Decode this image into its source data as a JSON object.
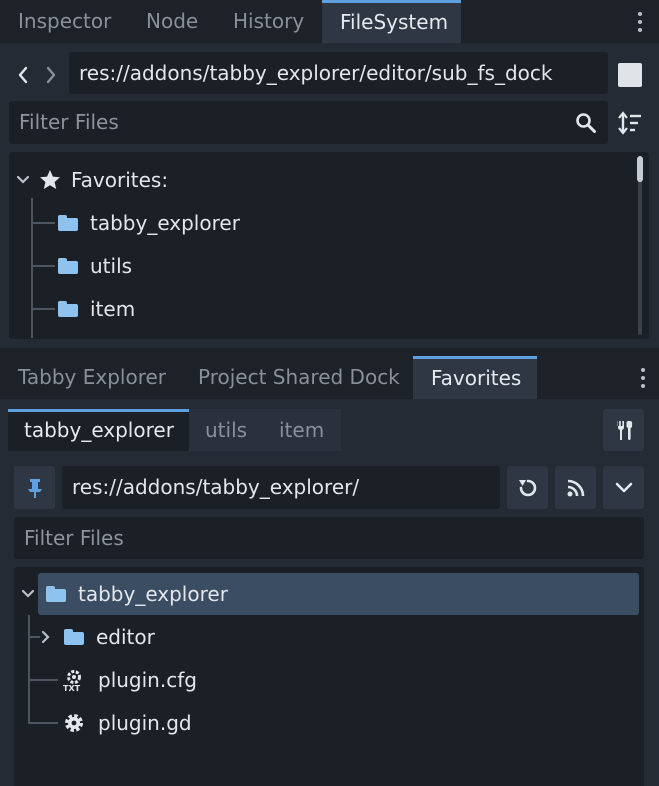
{
  "top_dock": {
    "tabs": [
      {
        "label": "Inspector",
        "active": false
      },
      {
        "label": "Node",
        "active": false
      },
      {
        "label": "History",
        "active": false
      },
      {
        "label": "FileSystem",
        "active": true
      }
    ],
    "path": "res://addons/tabby_explorer/editor/sub_fs_dock",
    "filter_placeholder": "Filter Files",
    "favorites": {
      "header": "Favorites:",
      "items": [
        "tabby_explorer",
        "utils",
        "item"
      ]
    }
  },
  "bottom_dock": {
    "tabs": [
      {
        "label": "Tabby Explorer",
        "active": false
      },
      {
        "label": "Project Shared Dock",
        "active": false
      },
      {
        "label": "Favorites",
        "active": true
      }
    ],
    "subtabs": [
      {
        "label": "tabby_explorer",
        "active": true
      },
      {
        "label": "utils",
        "active": false
      },
      {
        "label": "item",
        "active": false
      }
    ],
    "path": "res://addons/tabby_explorer/",
    "filter_placeholder": "Filter Files",
    "tree": {
      "root": "tabby_explorer",
      "children": [
        {
          "label": "editor",
          "type": "folder",
          "collapsed": true
        },
        {
          "label": "plugin.cfg",
          "type": "txt"
        },
        {
          "label": "plugin.gd",
          "type": "gear"
        }
      ]
    }
  },
  "colors": {
    "accent": "#5fa1e0",
    "folder": "#8fc3ef",
    "selection": "#3a4d63"
  },
  "icons": [
    "chevron-left-icon",
    "chevron-right-icon",
    "search-icon",
    "sort-icon",
    "star-icon",
    "folder-icon",
    "pin-icon",
    "reload-icon",
    "rss-icon",
    "chevron-down-icon",
    "settings-tools-icon",
    "txt-file-icon",
    "gear-icon"
  ]
}
